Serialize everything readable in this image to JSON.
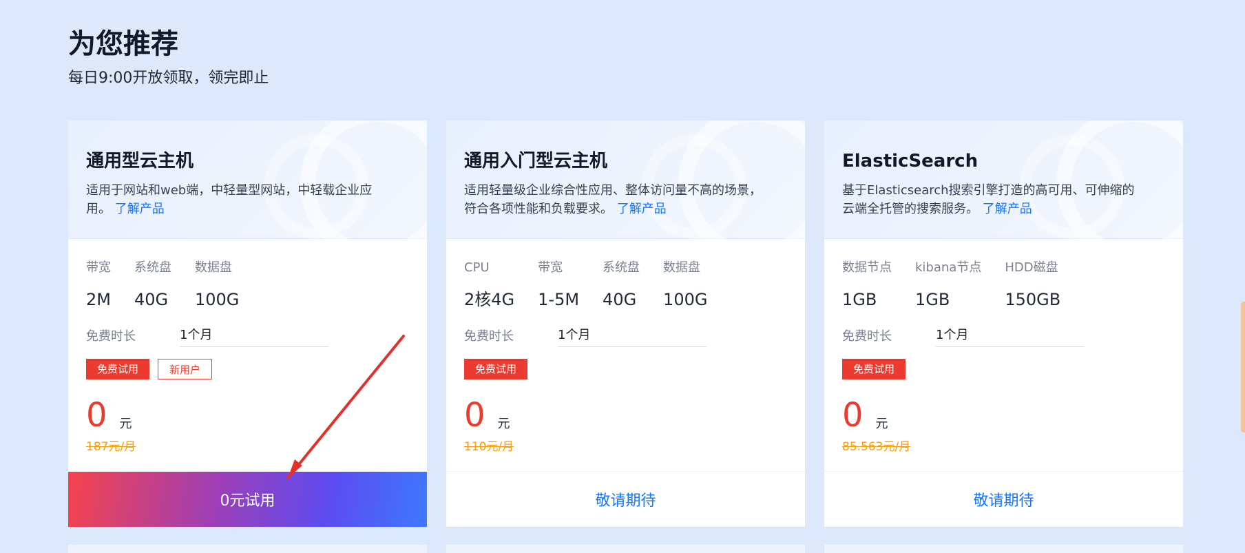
{
  "header": {
    "title": "为您推荐",
    "subtitle": "每日9:00开放领取，领完即止"
  },
  "cards": [
    {
      "title": "通用型云主机",
      "desc": "适用于网站和web端，中轻量型网站，中轻载企业应用。",
      "link": "了解产品",
      "specs": [
        {
          "label": "带宽",
          "value": "2M"
        },
        {
          "label": "系统盘",
          "value": "40G"
        },
        {
          "label": "数据盘",
          "value": "100G"
        }
      ],
      "duration_label": "免费时长",
      "duration_value": "1个月",
      "tags": [
        "免费试用",
        "新用户"
      ],
      "price": "0",
      "price_unit": "元",
      "old_price": "187元/月",
      "cta": "0元试用"
    },
    {
      "title": "通用入门型云主机",
      "desc": "适用轻量级企业综合性应用、整体访问量不高的场景，符合各项性能和负载要求。",
      "link": "了解产品",
      "specs": [
        {
          "label": "CPU",
          "value": "2核4G"
        },
        {
          "label": "带宽",
          "value": "1-5M"
        },
        {
          "label": "系统盘",
          "value": "40G"
        },
        {
          "label": "数据盘",
          "value": "100G"
        }
      ],
      "duration_label": "免费时长",
      "duration_value": "1个月",
      "tags": [
        "免费试用"
      ],
      "price": "0",
      "price_unit": "元",
      "old_price": "110元/月",
      "cta": "敬请期待"
    },
    {
      "title": "ElasticSearch",
      "desc": "基于Elasticsearch搜索引擎打造的高可用、可伸缩的云端全托管的搜索服务。",
      "link": "了解产品",
      "specs": [
        {
          "label": "数据节点",
          "value": "1GB"
        },
        {
          "label": "kibana节点",
          "value": "1GB"
        },
        {
          "label": "HDD磁盘",
          "value": "150GB"
        }
      ],
      "duration_label": "免费时长",
      "duration_value": "1个月",
      "tags": [
        "免费试用"
      ],
      "price": "0",
      "price_unit": "元",
      "old_price": "85.563元/月",
      "cta": "敬请期待"
    }
  ],
  "colors": {
    "background": "#dde8fb",
    "accent_red": "#eb3b31",
    "link_blue": "#1677ff",
    "old_price_orange": "#f59e0b",
    "annotation_arrow": "#e0312b"
  }
}
